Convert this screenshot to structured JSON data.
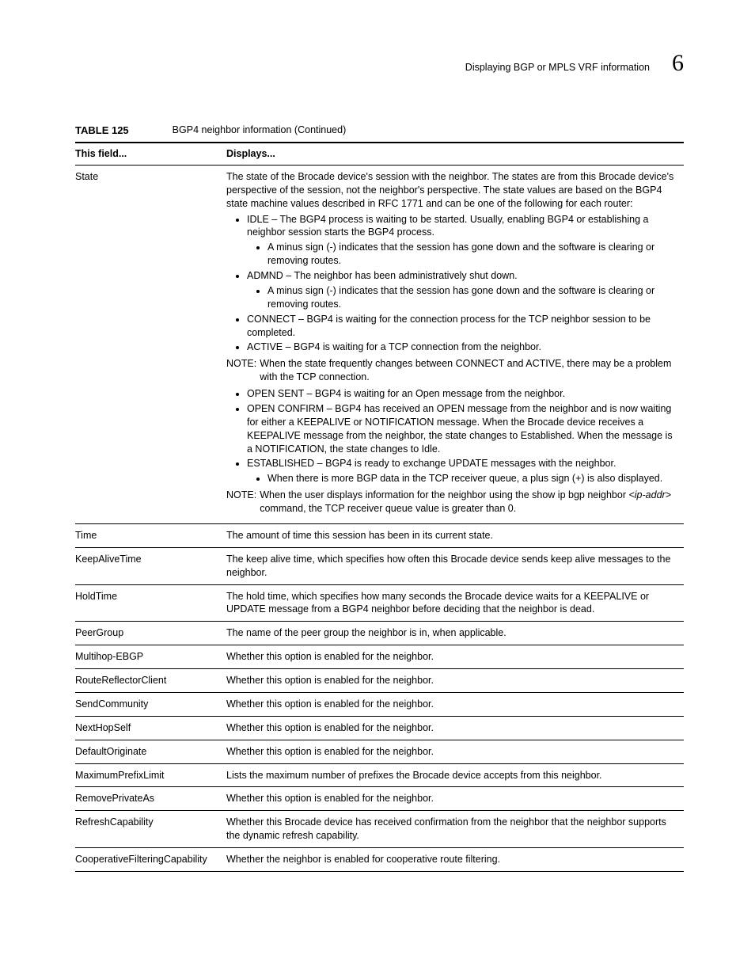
{
  "header": {
    "section_title": "Displaying BGP or MPLS VRF information",
    "chapter_number": "6"
  },
  "table": {
    "label": "TABLE 125",
    "title": "BGP4 neighbor information  (Continued)",
    "col1": "This field...",
    "col2": "Displays..."
  },
  "rows": {
    "state": {
      "field": "State",
      "intro": "The state of the Brocade device's session with the neighbor. The states are from this Brocade device's perspective of the session, not the neighbor's perspective. The state values are based on the BGP4 state machine values described in RFC 1771 and can be one of the following for each router:",
      "idle": "IDLE – The BGP4 process is waiting to be started. Usually, enabling BGP4 or establishing a neighbor session starts the BGP4 process.",
      "idle_sub": "A minus sign (-) indicates that the session has gone down and the software is clearing or removing routes.",
      "admnd": "ADMND – The neighbor has been administratively shut down.",
      "admnd_sub": "A minus sign (-) indicates that the session has gone down and the software is clearing or removing routes.",
      "connect": "CONNECT – BGP4 is waiting for the connection process for the TCP neighbor session to be completed.",
      "active": "ACTIVE – BGP4 is waiting for a TCP connection from the neighbor.",
      "note1_label": "NOTE:",
      "note1_body": "When the state frequently changes between CONNECT and ACTIVE, there may be a problem with the TCP connection.",
      "open_sent": "OPEN SENT – BGP4 is waiting for an Open message from the neighbor.",
      "open_confirm": "OPEN CONFIRM – BGP4 has received an OPEN message from the neighbor and is now waiting for either a KEEPALIVE or NOTIFICATION message. When the Brocade device receives a KEEPALIVE message from the neighbor, the state changes to Established. When the message is a NOTIFICATION, the state changes to Idle.",
      "established": "ESTABLISHED – BGP4 is ready to exchange UPDATE messages with the neighbor.",
      "established_sub": "When there is more BGP data in the TCP receiver queue, a plus sign (+) is also displayed.",
      "note2_label": "NOTE:",
      "note2_pre": "When the user displays information for the neighbor using the show ip bgp neighbor ",
      "note2_ip": "<ip-addr>",
      "note2_post": " command, the TCP receiver queue value is greater than 0."
    },
    "time": {
      "field": "Time",
      "desc": "The amount of time this session has been in its current state."
    },
    "keepalive": {
      "field": "KeepAliveTime",
      "desc": "The keep alive time, which specifies how often this Brocade device sends keep alive messages to the neighbor."
    },
    "holdtime": {
      "field": "HoldTime",
      "desc": "The hold time, which specifies how many seconds the Brocade device waits for a KEEPALIVE or UPDATE message from a BGP4 neighbor before deciding that the neighbor is dead."
    },
    "peergroup": {
      "field": "PeerGroup",
      "desc": "The name of the peer group the neighbor is in, when applicable."
    },
    "multihop": {
      "field": "Multihop-EBGP",
      "desc": "Whether this option is enabled for the neighbor."
    },
    "rrclient": {
      "field": "RouteReflectorClient",
      "desc": "Whether this option is enabled for the neighbor."
    },
    "sendcomm": {
      "field": "SendCommunity",
      "desc": "Whether this option is enabled for the neighbor."
    },
    "nexthop": {
      "field": "NextHopSelf",
      "desc": "Whether this option is enabled for the neighbor."
    },
    "deforig": {
      "field": "DefaultOriginate",
      "desc": "Whether this option is enabled for the neighbor."
    },
    "maxprefix": {
      "field": "MaximumPrefixLimit",
      "desc": "Lists the maximum number of prefixes the Brocade device accepts from this neighbor."
    },
    "removepriv": {
      "field": "RemovePrivateAs",
      "desc": "Whether this option is enabled for the neighbor."
    },
    "refresh": {
      "field": "RefreshCapability",
      "desc": "Whether this Brocade device has received confirmation from the neighbor that the neighbor supports the dynamic refresh capability."
    },
    "coop": {
      "field": "CooperativeFilteringCapability",
      "desc": "Whether the neighbor is enabled for cooperative route filtering."
    }
  }
}
